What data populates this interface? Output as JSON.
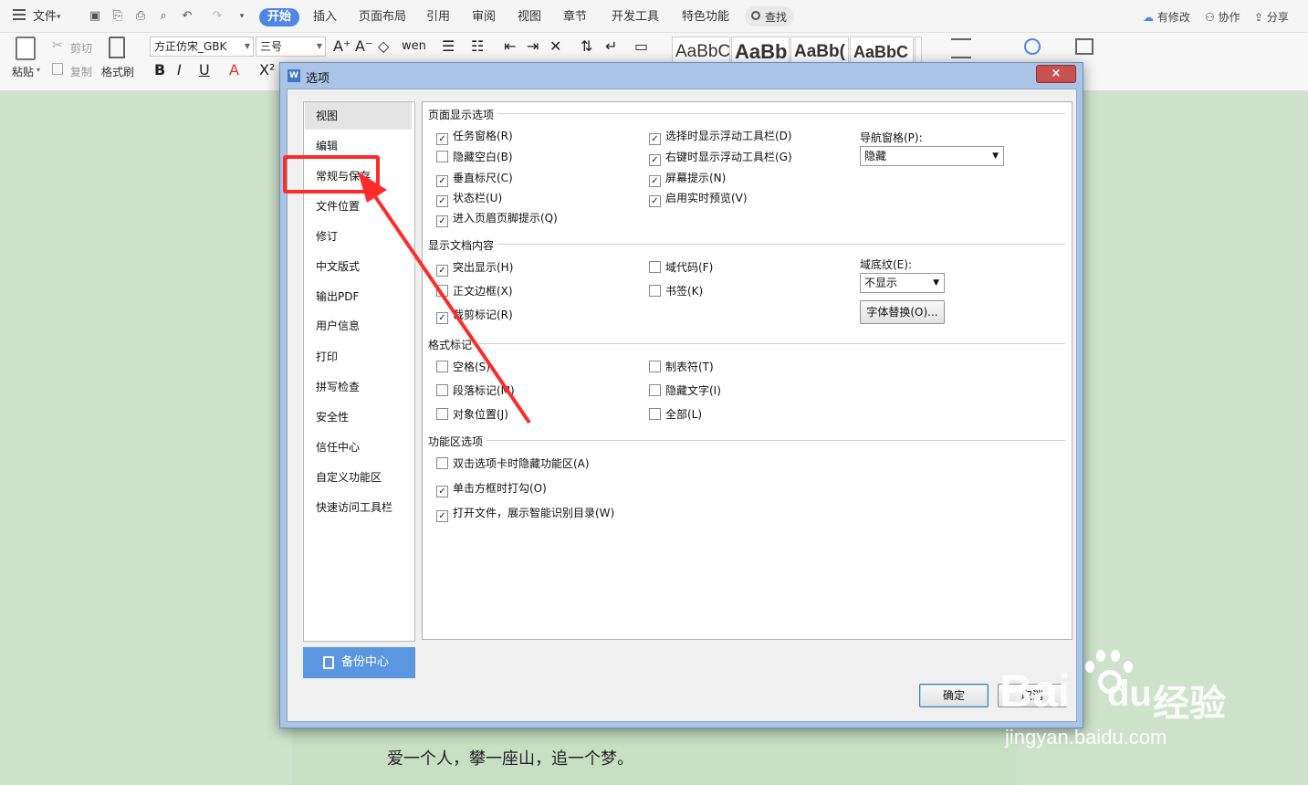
{
  "toolbar": {
    "menu": "文件",
    "tabs": [
      "开始",
      "插入",
      "页面布局",
      "引用",
      "审阅",
      "视图",
      "章节",
      "开发工具",
      "特色功能"
    ],
    "search": "查找",
    "right_actions": [
      "有修改",
      "协作",
      "分享"
    ],
    "clipboard": {
      "paste": "粘贴",
      "cut": "剪切",
      "copy": "复制",
      "format_painter": "格式刷"
    },
    "font_name": "方正仿宋_GBK",
    "font_size": "三号",
    "style_samples": [
      "AaBbC",
      "AaBb",
      "AaBb(",
      "AaBbC"
    ]
  },
  "document": {
    "text": "爱一个人，攀一座山，追一个梦。"
  },
  "dialog": {
    "title": "选项",
    "close": "×",
    "nav": [
      "视图",
      "编辑",
      "常规与保存",
      "文件位置",
      "修订",
      "中文版式",
      "输出PDF",
      "用户信息",
      "打印",
      "拼写检查",
      "安全性",
      "信任中心",
      "自定义功能区",
      "快速访问工具栏"
    ],
    "selected_nav": "视图",
    "backup": "备份中心",
    "sections": {
      "page_display": "页面显示选项",
      "doc_content": "显示文档内容",
      "format_marks": "格式标记",
      "ribbon": "功能区选项"
    },
    "page_display": {
      "col1": [
        {
          "label": "任务窗格(R)",
          "checked": true
        },
        {
          "label": "隐藏空白(B)",
          "checked": false
        },
        {
          "label": "垂直标尺(C)",
          "checked": true
        },
        {
          "label": "状态栏(U)",
          "checked": true
        },
        {
          "label": "进入页眉页脚提示(Q)",
          "checked": true
        }
      ],
      "col2": [
        {
          "label": "选择时显示浮动工具栏(D)",
          "checked": true
        },
        {
          "label": "右键时显示浮动工具栏(G)",
          "checked": true
        },
        {
          "label": "屏幕提示(N)",
          "checked": true
        },
        {
          "label": "启用实时预览(V)",
          "checked": true
        }
      ],
      "nav_pane_label": "导航窗格(P):",
      "nav_pane_value": "隐藏"
    },
    "doc_content": {
      "col1": [
        {
          "label": "突出显示(H)",
          "checked": true
        },
        {
          "label": "正文边框(X)",
          "checked": false
        },
        {
          "label": "裁剪标记(R)",
          "checked": true
        }
      ],
      "col2": [
        {
          "label": "域代码(F)",
          "checked": false
        },
        {
          "label": "书签(K)",
          "checked": false
        }
      ],
      "field_shading_label": "域底纹(E):",
      "field_shading_value": "不显示",
      "font_sub_button": "字体替换(O)..."
    },
    "format_marks": {
      "col1": [
        {
          "label": "空格(S)",
          "checked": false
        },
        {
          "label": "段落标记(M)",
          "checked": false
        },
        {
          "label": "对象位置(J)",
          "checked": false
        }
      ],
      "col2": [
        {
          "label": "制表符(T)",
          "checked": false
        },
        {
          "label": "隐藏文字(I)",
          "checked": false
        },
        {
          "label": "全部(L)",
          "checked": false
        }
      ]
    },
    "ribbon_opts": [
      {
        "label": "双击选项卡时隐藏功能区(A)",
        "checked": false
      },
      {
        "label": "单击方框时打勾(O)",
        "checked": true
      },
      {
        "label": "打开文件，展示智能识别目录(W)",
        "checked": true
      }
    ],
    "ok": "确定",
    "cancel": "取消"
  },
  "watermark": {
    "brand": "Bai",
    "brand2": "du",
    "cn": "经验",
    "url": "jingyan.baidu.com"
  },
  "colors": {
    "accent": "#4f86e6",
    "annotation": "#ff2b2b",
    "backup": "#5b97e1"
  }
}
